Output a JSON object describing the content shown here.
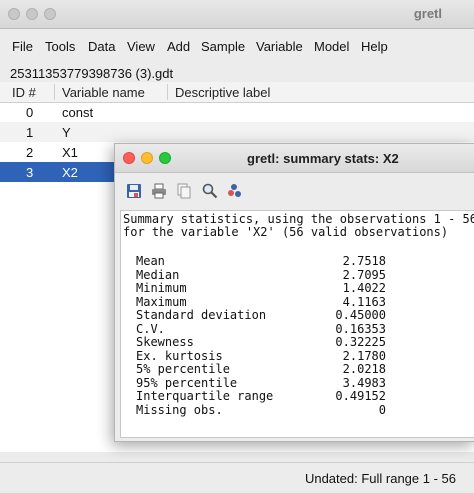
{
  "main_window": {
    "title": "gretl",
    "menu": [
      "File",
      "Tools",
      "Data",
      "View",
      "Add",
      "Sample",
      "Variable",
      "Model",
      "Help"
    ],
    "filename": "25311353779398736 (3).gdt",
    "columns": {
      "id": "ID #",
      "name": "Variable name",
      "label": "Descriptive label"
    },
    "rows": [
      {
        "id": "0",
        "name": "const"
      },
      {
        "id": "1",
        "name": "Y"
      },
      {
        "id": "2",
        "name": "X1"
      },
      {
        "id": "3",
        "name": "X2"
      }
    ],
    "status": "Undated: Full range 1 - 56"
  },
  "summary_window": {
    "title": "gretl: summary stats: X2",
    "toolbar_icons": [
      "save-icon",
      "print-icon",
      "copy-icon",
      "find-icon",
      "chart-icon"
    ],
    "header_lines": [
      "Summary statistics, using the observations 1 - 56",
      "for the variable 'X2' (56 valid observations)"
    ],
    "stats": [
      {
        "label": "Mean",
        "value": "2.7518"
      },
      {
        "label": "Median",
        "value": "2.7095"
      },
      {
        "label": "Minimum",
        "value": "1.4022"
      },
      {
        "label": "Maximum",
        "value": "4.1163"
      },
      {
        "label": "Standard deviation",
        "value": "0.45000"
      },
      {
        "label": "C.V.",
        "value": "0.16353"
      },
      {
        "label": "Skewness",
        "value": "0.32225"
      },
      {
        "label": "Ex. kurtosis",
        "value": "2.1780"
      },
      {
        "label": "5% percentile",
        "value": "2.0218"
      },
      {
        "label": "95% percentile",
        "value": "3.4983"
      },
      {
        "label": "Interquartile range",
        "value": "0.49152"
      },
      {
        "label": "Missing obs.",
        "value": "0"
      }
    ]
  },
  "colors": {
    "selection": "#2e63b8",
    "close": "#ff5f57",
    "minimize": "#febc2e",
    "zoom": "#28c840"
  }
}
